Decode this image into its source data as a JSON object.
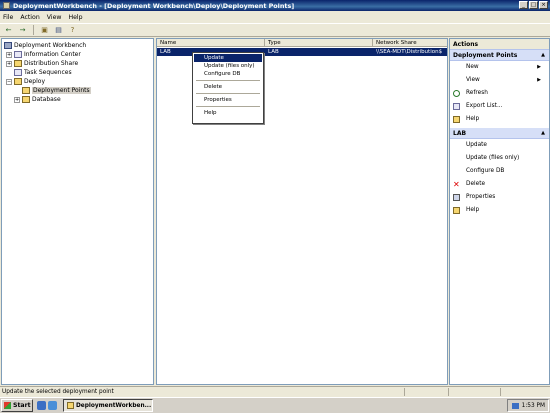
{
  "window": {
    "title": "DeploymentWorkbench - [Deployment Workbench\\Deploy\\Deployment Points]",
    "buttons": [
      "_",
      "□",
      "×"
    ]
  },
  "menubar": [
    "File",
    "Action",
    "View",
    "Help"
  ],
  "toolbar": [
    "back-icon",
    "forward-icon",
    "up-icon",
    "properties-icon",
    "help-icon"
  ],
  "tree": {
    "root": "Deployment Workbench",
    "nodes": [
      "Information Center",
      "Distribution Share",
      "Task Sequences",
      "Deploy",
      "Deployment Points",
      "Database"
    ]
  },
  "list": {
    "columns": [
      "Name",
      "Type",
      "Network Share"
    ],
    "rows": [
      {
        "name": "LAB",
        "type": "LAB",
        "share": "\\\\SEA-MDT\\Distribution$"
      }
    ]
  },
  "context_menu": [
    "Update",
    "Update (files only)",
    "Configure DB",
    "Delete",
    "Properties",
    "Help"
  ],
  "actions": {
    "title": "Actions",
    "section1": "Deployment Points",
    "section1_items": [
      "New",
      "View",
      "Refresh",
      "Export List...",
      "Help"
    ],
    "section2": "LAB",
    "section2_items": [
      "Update",
      "Update (files only)",
      "Configure DB",
      "Delete",
      "Properties",
      "Help"
    ]
  },
  "statusbar": "Update the selected deployment point",
  "taskbar": {
    "start": "Start",
    "task": "DeploymentWorkben...",
    "clock": "1:53 PM"
  }
}
